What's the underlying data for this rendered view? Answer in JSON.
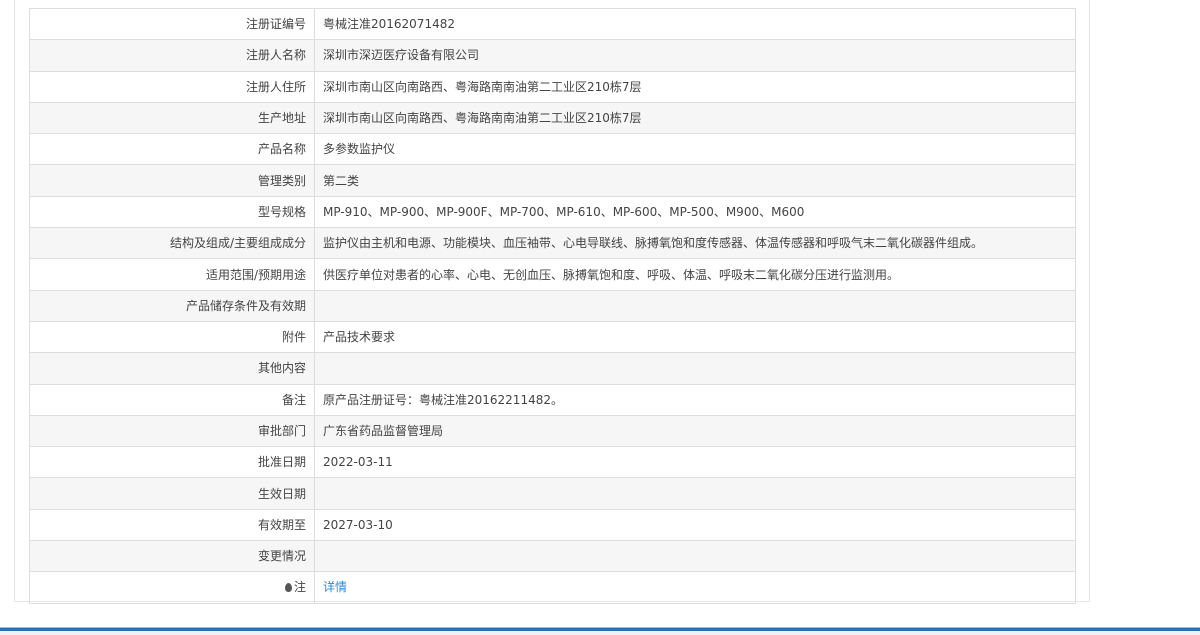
{
  "rows": [
    {
      "label": "注册证编号",
      "value": "粤械注准20162071482"
    },
    {
      "label": "注册人名称",
      "value": "深圳市深迈医疗设备有限公司"
    },
    {
      "label": "注册人住所",
      "value": "深圳市南山区向南路西、粤海路南南油第二工业区210栋7层"
    },
    {
      "label": "生产地址",
      "value": "深圳市南山区向南路西、粤海路南南油第二工业区210栋7层"
    },
    {
      "label": "产品名称",
      "value": "多参数监护仪"
    },
    {
      "label": "管理类别",
      "value": "第二类"
    },
    {
      "label": "型号规格",
      "value": "MP-910、MP-900、MP-900F、MP-700、MP-610、MP-600、MP-500、M900、M600"
    },
    {
      "label": "结构及组成/主要组成成分",
      "value": "监护仪由主机和电源、功能模块、血压袖带、心电导联线、脉搏氧饱和度传感器、体温传感器和呼吸气末二氧化碳器件组成。"
    },
    {
      "label": "适用范围/预期用途",
      "value": "供医疗单位对患者的心率、心电、无创血压、脉搏氧饱和度、呼吸、体温、呼吸末二氧化碳分压进行监测用。"
    },
    {
      "label": "产品储存条件及有效期",
      "value": ""
    },
    {
      "label": "附件",
      "value": "产品技术要求"
    },
    {
      "label": "其他内容",
      "value": ""
    },
    {
      "label": "备注",
      "value": "原产品注册证号：粤械注准20162211482。"
    },
    {
      "label": "审批部门",
      "value": "广东省药品监督管理局"
    },
    {
      "label": "批准日期",
      "value": "2022-03-11"
    },
    {
      "label": "生效日期",
      "value": ""
    },
    {
      "label": "有效期至",
      "value": "2027-03-10"
    },
    {
      "label": "变更情况",
      "value": ""
    }
  ],
  "note": {
    "label": "注",
    "link": "详情",
    "icon": "map-pin-icon"
  }
}
